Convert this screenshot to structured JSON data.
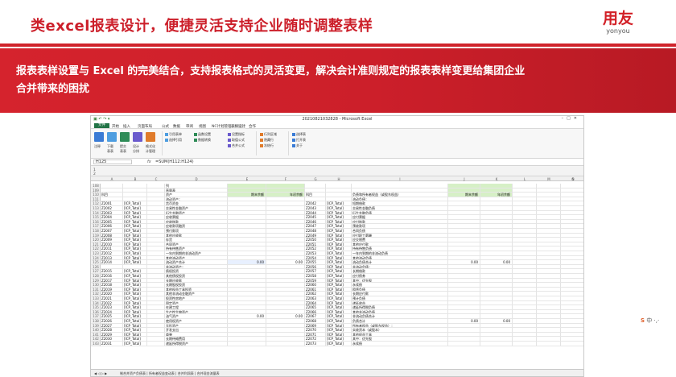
{
  "slide": {
    "title": "类excel报表设计，便捷灵活支持企业随时调整表样",
    "logo_main": "用友",
    "logo_sub": "yonyou",
    "banner_line1": "报表表样设置与 Excel 的完美结合，支持报表格式的灵活变更，解决会计准则规定的报表表样变更给集团企业",
    "banner_line2": "合并带来的困扰"
  },
  "excel": {
    "window_title": "20210821032828 - Microsoft Excel",
    "menu": [
      "文件",
      "开始",
      "插入",
      "页面布局",
      "公式",
      "数据",
      "审阅",
      "视图",
      "NC计划管理",
      "表样设计",
      "合作"
    ],
    "ribbon": {
      "big_buttons": [
        "注释",
        "下载",
        "提交",
        "设计",
        "格式化"
      ],
      "big_buttons_row2": [
        "",
        "表表",
        "表表",
        "分排",
        "计管理"
      ],
      "small_col1": [
        "引用表单",
        "选择引用",
        "函数设置",
        "数据转换"
      ],
      "small_col2": [
        "设置指标",
        "取值公式",
        "合并公式"
      ],
      "small_col3": [
        "行列区域",
        "隐藏行",
        "冻结行"
      ],
      "small_col4": [
        "选择表",
        "打开表",
        "关于"
      ]
    },
    "name_box": "H125",
    "formula": "=SUM(H112:H124)",
    "columns": [
      "A",
      "B",
      "C",
      "D",
      "E",
      "F",
      "G",
      "H",
      "I",
      "J",
      "K",
      "L",
      "M",
      "N",
      "O"
    ],
    "rows": [
      {
        "n": "108",
        "a": "",
        "b": "",
        "c": "",
        "d": "列",
        "e": "",
        "f": "",
        "g": "",
        "h": "",
        "i": "",
        "j": ""
      },
      {
        "n": "109",
        "a": "",
        "b": "",
        "c": "",
        "d": "直量表",
        "e": "",
        "f": "",
        "g": "",
        "h": "",
        "i": "",
        "j": ""
      },
      {
        "n": "110",
        "a": "科目",
        "b": "",
        "c": "",
        "d": "资产",
        "e": "期末余额",
        "f": "年初余额",
        "g": "科目",
        "h": "",
        "i": "负债和所有者权益（或股东权益）",
        "j": "期末余额",
        "k": "年初余额"
      },
      {
        "n": "111",
        "a": "",
        "b": "",
        "c": "",
        "d": "流动资产：",
        "e": "",
        "f": "",
        "g": "",
        "h": "",
        "i": "流动负债："
      },
      {
        "n": "112",
        "a": "Z2001",
        "b": "[ICP_Total]",
        "d": "货币资金",
        "g": "Z2042",
        "h": "[ICP_Total]",
        "i": "短期借款"
      },
      {
        "n": "113",
        "a": "Z2002",
        "b": "[ICP_Total]",
        "d": "交易性金融资产",
        "g": "Z2043",
        "h": "[ICP_Total]",
        "i": "交易性金融负债"
      },
      {
        "n": "114",
        "a": "Z2003",
        "b": "[ICP_Total]",
        "d": "衍生金融资产",
        "g": "Z2044",
        "h": "[ICP_Total]",
        "i": "衍生金融负债"
      },
      {
        "n": "115",
        "a": "Z2004",
        "b": "[ICP_Total]",
        "d": "应收票据",
        "g": "Z2045",
        "h": "[ICP_Total]",
        "i": "应付票据"
      },
      {
        "n": "116",
        "a": "Z2005",
        "b": "[ICP_Total]",
        "d": "应收账款",
        "g": "Z2046",
        "h": "[ICP_Total]",
        "i": "应付账款"
      },
      {
        "n": "117",
        "a": "Z2006",
        "b": "[ICP_Total]",
        "d": "应收款项融资",
        "g": "Z2047",
        "h": "[ICP_Total]",
        "i": "预收款项"
      },
      {
        "n": "118",
        "a": "Z2007",
        "b": "[ICP_Total]",
        "d": "预付款项",
        "g": "Z2048",
        "h": "[ICP_Total]",
        "i": "合同负债"
      },
      {
        "n": "119",
        "a": "Z2008",
        "b": "[ICP_Total]",
        "d": "其他应收款",
        "g": "Z2049",
        "h": "[ICP_Total]",
        "i": "应付职工薪酬"
      },
      {
        "n": "120",
        "a": "Z2009",
        "b": "[ICP_Total]",
        "d": "存货",
        "g": "Z2050",
        "h": "[ICP_Total]",
        "i": "应交税费"
      },
      {
        "n": "121",
        "a": "Z2010",
        "b": "[ICP_Total]",
        "d": "合同资产",
        "g": "Z2051",
        "h": "[ICP_Total]",
        "i": "其他应付款"
      },
      {
        "n": "122",
        "a": "Z2011",
        "b": "[ICP_Total]",
        "d": "持有待售资产",
        "g": "Z2052",
        "h": "[ICP_Total]",
        "i": "持有待售负债"
      },
      {
        "n": "123",
        "a": "Z2012",
        "b": "[ICP_Total]",
        "d": "一年内到期的非流动资产",
        "g": "Z2053",
        "h": "[ICP_Total]",
        "i": "一年内到期的非流动负债"
      },
      {
        "n": "124",
        "a": "Z2013",
        "b": "[ICP_Total]",
        "d": "其他流动资产",
        "g": "Z2054",
        "h": "[ICP_Total]",
        "i": "其他流动负债"
      },
      {
        "n": "125",
        "a": "Z2014",
        "b": "[ICP_Total]",
        "d": "流动资产合计",
        "e": "0.00",
        "f": "0.00",
        "g": "Z2055",
        "h": "[ICP_Total]",
        "i": "流动负债合计",
        "j": "0.00",
        "k": "0.00"
      },
      {
        "n": "126",
        "a": "",
        "b": "",
        "d": "非流动资产：",
        "g": "Z2056",
        "h": "[ICP_Total]",
        "i": "非流动负债："
      },
      {
        "n": "127",
        "a": "Z2015",
        "b": "[ICP_Total]",
        "d": "债权投资",
        "g": "Z2057",
        "h": "[ICP_Total]",
        "i": "长期借款"
      },
      {
        "n": "128",
        "a": "Z2016",
        "b": "[ICP_Total]",
        "d": "其他债权投资",
        "g": "Z2058",
        "h": "[ICP_Total]",
        "i": "应付债券"
      },
      {
        "n": "129",
        "a": "Z2017",
        "b": "[ICP_Total]",
        "d": "长期应收款",
        "g": "Z2059",
        "h": "[ICP_Total]",
        "i": "其中：优先股"
      },
      {
        "n": "130",
        "a": "Z2018",
        "b": "[ICP_Total]",
        "d": "长期股权投资",
        "g": "Z2060",
        "h": "[ICP_Total]",
        "i": "永续债"
      },
      {
        "n": "131",
        "a": "Z2019",
        "b": "[ICP_Total]",
        "d": "其他权益工具投资",
        "g": "Z2061",
        "h": "[ICP_Total]",
        "i": "租赁负债"
      },
      {
        "n": "132",
        "a": "Z2020",
        "b": "[ICP_Total]",
        "d": "其他非流动金融资产",
        "g": "Z2062",
        "h": "[ICP_Total]",
        "i": "长期应付款"
      },
      {
        "n": "133",
        "a": "Z2021",
        "b": "[ICP_Total]",
        "d": "投资性房地产",
        "g": "Z2063",
        "h": "[ICP_Total]",
        "i": "预计负债"
      },
      {
        "n": "134",
        "a": "Z2022",
        "b": "[ICP_Total]",
        "d": "固定资产",
        "g": "Z2064",
        "h": "[ICP_Total]",
        "i": "递延收益"
      },
      {
        "n": "135",
        "a": "Z2023",
        "b": "[ICP_Total]",
        "d": "在建工程",
        "g": "Z2065",
        "h": "[ICP_Total]",
        "i": "递延所得税负债"
      },
      {
        "n": "136",
        "a": "Z2024",
        "b": "[ICP_Total]",
        "d": "生产性生物资产",
        "g": "Z2066",
        "h": "[ICP_Total]",
        "i": "其他非流动负债"
      },
      {
        "n": "137",
        "a": "Z2025",
        "b": "[ICP_Total]",
        "d": "油气资产",
        "e": "0.00",
        "f": "0.00",
        "g": "Z2067",
        "h": "[ICP_Total]",
        "i": "非流动负债合计"
      },
      {
        "n": "138",
        "a": "Z2026",
        "b": "[ICP_Total]",
        "d": "使用权资产",
        "g": "Z2068",
        "h": "[ICP_Total]",
        "i": "负债合计",
        "j": "0.00",
        "k": "0.00"
      },
      {
        "n": "139",
        "a": "Z2027",
        "b": "[ICP_Total]",
        "d": "无形资产",
        "g": "Z2069",
        "h": "[ICP_Total]",
        "i": "所有者权益（或股东权益）："
      },
      {
        "n": "140",
        "a": "Z2028",
        "b": "[ICP_Total]",
        "d": "开发支出",
        "g": "Z2070",
        "h": "[ICP_Total]",
        "i": "实收资本（或股本）"
      },
      {
        "n": "141",
        "a": "Z2029",
        "b": "[ICP_Total]",
        "d": "商誉",
        "g": "Z2071",
        "h": "[ICP_Total]",
        "i": "其他权益工具"
      },
      {
        "n": "142",
        "a": "Z2030",
        "b": "[ICP_Total]",
        "d": "长期待摊费用",
        "g": "Z2072",
        "h": "[ICP_Total]",
        "i": "其中：优先股"
      },
      {
        "n": "143",
        "a": "Z2031",
        "b": "[ICP_Total]",
        "d": "递延所得税资产",
        "g": "Z2073",
        "h": "[ICP_Total]",
        "i": "永续债"
      }
    ],
    "sheet_tabs": "制合并资产负债表 | 所有者权益变动表 | 合并利润表 | 合并现金流量表",
    "ime_label": "中"
  }
}
